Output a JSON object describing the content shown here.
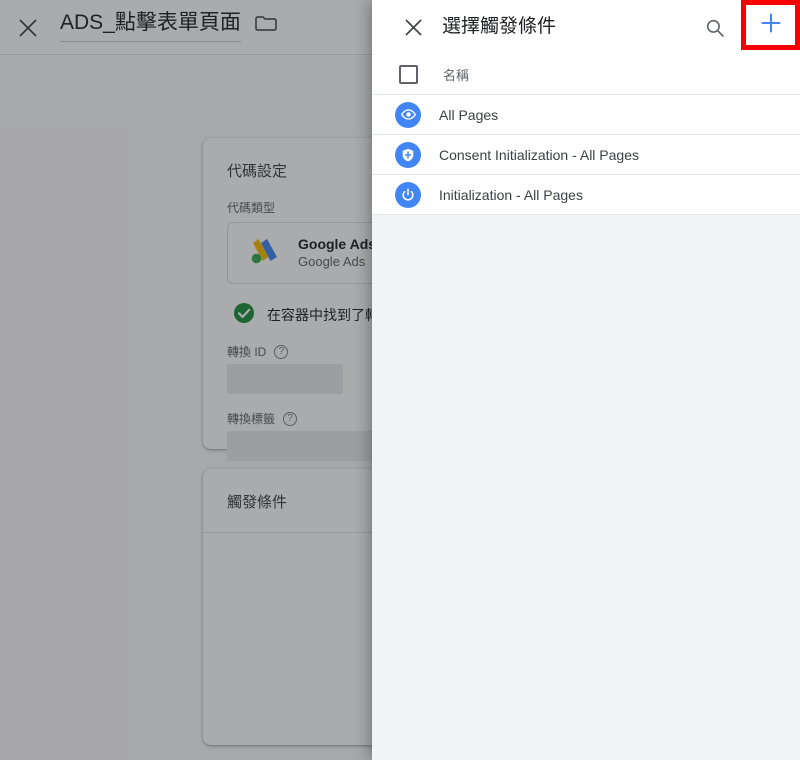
{
  "editor": {
    "close_icon": "close-icon",
    "title": "ADS_點擊表單頁面",
    "folder_icon": "folder-icon",
    "tag_config_card": {
      "title": "代碼設定",
      "type_label": "代碼類型",
      "type_name": "Google Ads",
      "type_subtitle": "Google Ads",
      "type_icon": "google-ads-icon",
      "found_icon": "check-circle-icon",
      "found_text": "在容器中找到了轉換 ID",
      "conversion_id_label": "轉換 ID",
      "conversion_id_value": "",
      "conversion_label_label": "轉換標籤",
      "conversion_label_value": "",
      "help_icon": "help-icon"
    },
    "triggering_card": {
      "title": "觸發條件"
    }
  },
  "panel": {
    "close_icon": "close-icon",
    "title": "選擇觸發條件",
    "search_icon": "search-icon",
    "add_icon": "plus-icon",
    "highlight_color": "#fb0000",
    "accent_color": "#4285f4",
    "list_header": {
      "checkbox": "select-all-checkbox",
      "name_column": "名稱"
    },
    "triggers": [
      {
        "name": "All Pages",
        "icon": "pageview-eye-icon"
      },
      {
        "name": "Consent Initialization - All Pages",
        "icon": "shield-icon"
      },
      {
        "name": "Initialization - All Pages",
        "icon": "power-icon"
      }
    ]
  }
}
